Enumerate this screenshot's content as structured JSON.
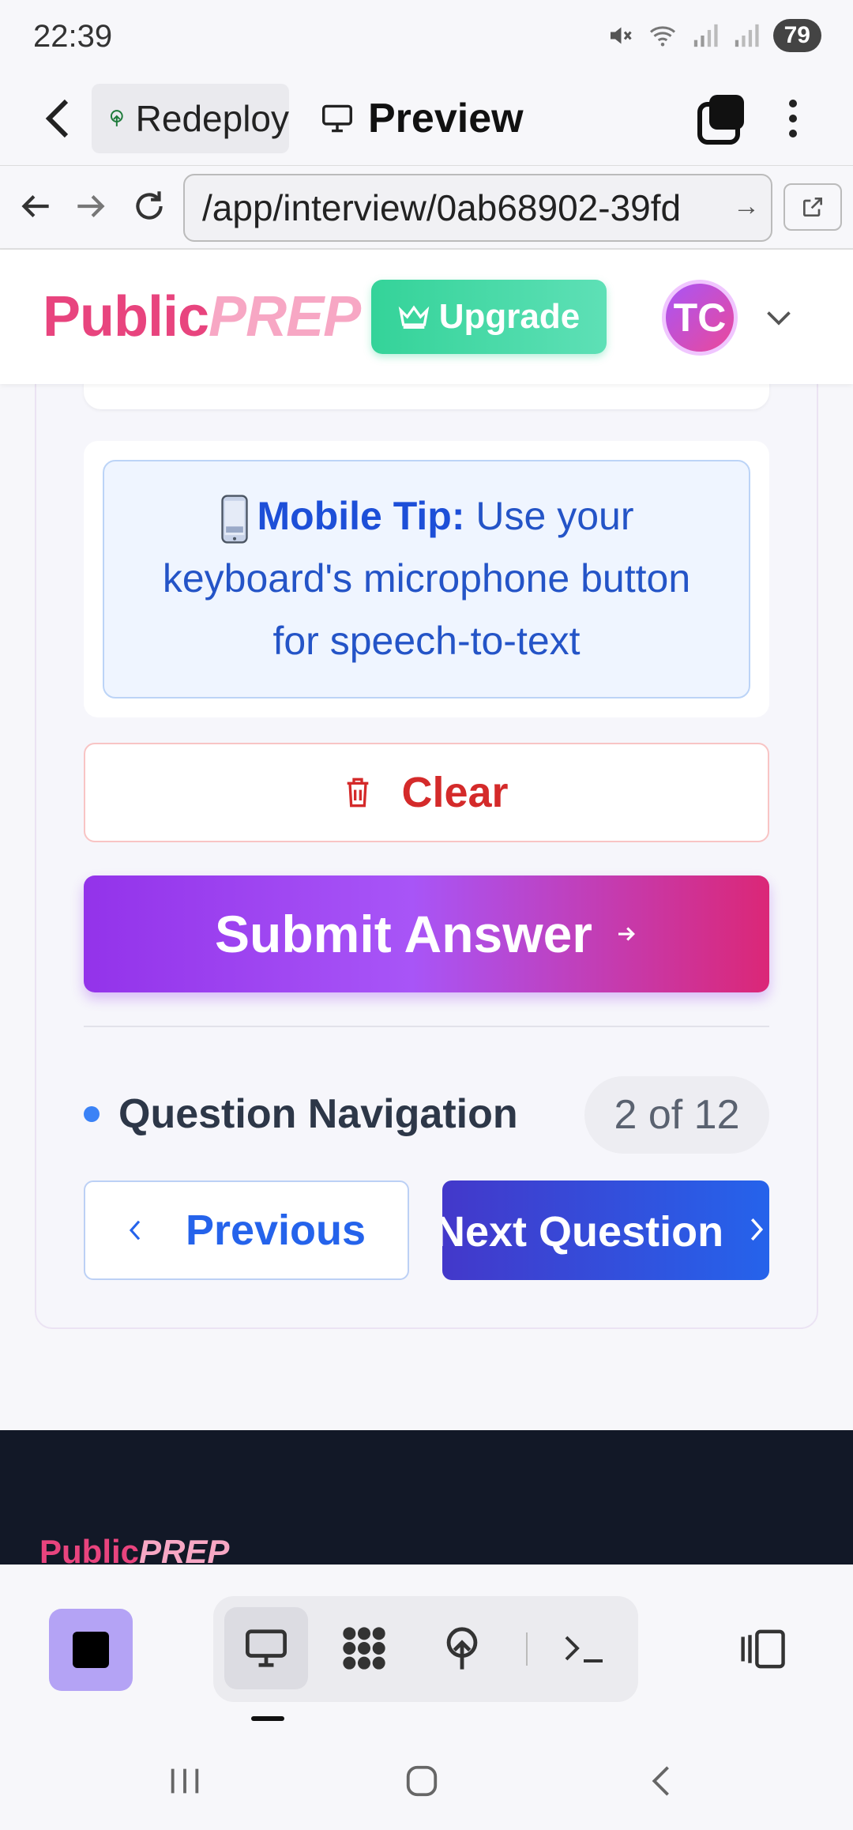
{
  "status_bar": {
    "time": "22:39",
    "battery": "79"
  },
  "browser": {
    "tab_label": "Redeploy",
    "preview_label": "Preview",
    "url": "/app/interview/0ab68902-39fd"
  },
  "header": {
    "logo_public": "Public",
    "logo_prep": "PREP",
    "upgrade_label": "Upgrade",
    "avatar_initials": "TC"
  },
  "tip": {
    "title": "Mobile Tip:",
    "text": "Use your keyboard's microphone button for speech-to-text"
  },
  "actions": {
    "clear_label": "Clear",
    "submit_label": "Submit Answer"
  },
  "question_nav": {
    "title": "Question Navigation",
    "count": "2 of 12",
    "previous_label": "Previous",
    "next_label": "Next Question"
  },
  "footer": {
    "logo_public": "Public",
    "logo_prep": "PREP"
  },
  "colors": {
    "brand_pink": "#e8447e",
    "upgrade_green": "#34d399",
    "submit_gradient_start": "#9333ea",
    "submit_gradient_end": "#db2777",
    "next_blue": "#2563eb",
    "clear_red": "#d42a2a"
  }
}
